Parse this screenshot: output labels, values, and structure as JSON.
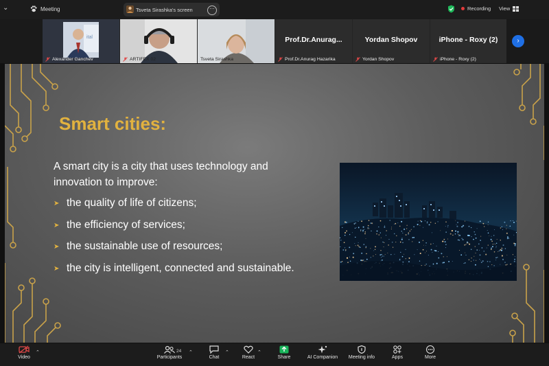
{
  "topbar": {
    "meeting_label": "Meeting",
    "share_label": "Tsveta Sirashka's screen",
    "recording_label": "Recording",
    "view_label": "View"
  },
  "participants": [
    {
      "name": "Alexander Ganchev",
      "type": "video",
      "muted": true
    },
    {
      "name": "ARTIFEX 02",
      "type": "video",
      "muted": true
    },
    {
      "name": "Tsveta Sirashka",
      "type": "video",
      "muted": false,
      "active_speaker": true
    },
    {
      "name": "Prof.Dr.Anurag Hazarika",
      "display_title": "Prof.Dr.Anurag...",
      "type": "name",
      "muted": true
    },
    {
      "name": "Yordan Shopov",
      "display_title": "Yordan Shopov",
      "type": "name",
      "muted": true
    },
    {
      "name": "iPhone - Roxy (2)",
      "display_title": "iPhone - Roxy (2)",
      "type": "name",
      "muted": true
    }
  ],
  "slide": {
    "title": "Smart cities:",
    "intro": "A smart city is a city that uses technology and innovation to improve:",
    "bullets": [
      "the quality of life of citizens;",
      "the efficiency of services;",
      "the sustainable use of resources;",
      "the city is intelligent, connected and sustainable."
    ],
    "accent_color": "#e2b23f"
  },
  "toolbar": {
    "video_label": "Video",
    "participants_label": "Participants",
    "participants_count": "24",
    "chat_label": "Chat",
    "react_label": "React",
    "share_label": "Share",
    "ai_label": "AI Companion",
    "info_label": "Meeting info",
    "apps_label": "Apps",
    "more_label": "More",
    "share_color": "#19b45a"
  }
}
